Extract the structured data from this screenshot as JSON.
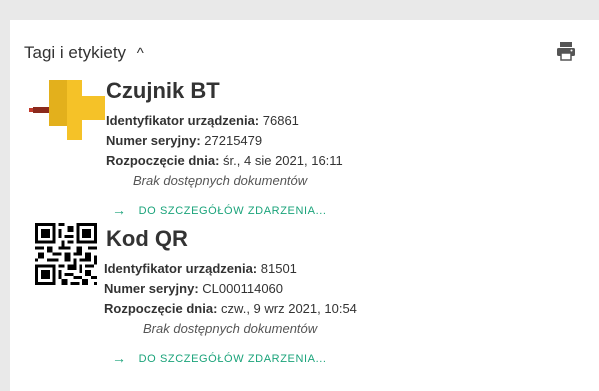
{
  "section": {
    "title": "Tagi i etykiety",
    "collapse_icon": "chevron-up-icon",
    "print_icon": "printer-icon"
  },
  "items": [
    {
      "title": "Czujnik BT",
      "image_icon": "bt-sensor-icon",
      "device_id_label": "Identyfikator urządzenia:",
      "device_id": "76861",
      "serial_label": "Numer seryjny:",
      "serial": "27215479",
      "start_label": "Rozpoczęcie dnia:",
      "start": "śr., 4 sie 2021, 16:11",
      "documents": "Brak dostępnych dokumentów",
      "link": "DO SZCZEGÓŁÓW ZDARZENIA..."
    },
    {
      "title": "Kod QR",
      "image_icon": "qr-code-icon",
      "device_id_label": "Identyfikator urządzenia:",
      "device_id": "81501",
      "serial_label": "Numer seryjny:",
      "serial": "CL000114060",
      "start_label": "Rozpoczęcie dnia:",
      "start": "czw., 9 wrz 2021, 10:54",
      "documents": "Brak dostępnych dokumentów",
      "link": "DO SZCZEGÓŁÓW ZDARZENIA..."
    }
  ],
  "colors": {
    "link": "#1aa37a",
    "sensor_yellow": "#f5c228",
    "sensor_red": "#c0392b"
  }
}
